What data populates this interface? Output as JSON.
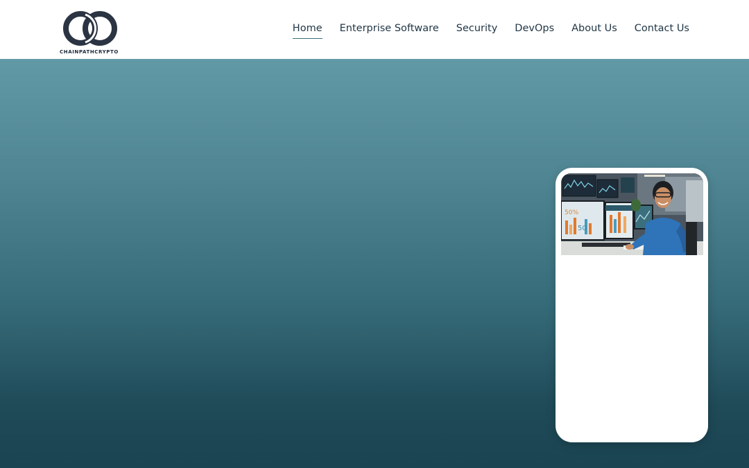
{
  "brand": {
    "name": "CHAINPATHCRYPTO",
    "logo_icon": "interlocking-rings-icon",
    "logo_color": "#2b3442"
  },
  "nav": {
    "items": [
      {
        "label": "Home",
        "active": true
      },
      {
        "label": "Enterprise Software",
        "active": false
      },
      {
        "label": "Security",
        "active": false
      },
      {
        "label": "DevOps",
        "active": false
      },
      {
        "label": "About Us",
        "active": false
      },
      {
        "label": "Contact Us",
        "active": false
      }
    ]
  },
  "hero": {
    "gradient_top": "#6199a7",
    "gradient_bottom": "#1b4452"
  },
  "card": {
    "image": "man-at-computer-with-dashboards-photo",
    "screen_labels": [
      "50%",
      "50"
    ]
  }
}
